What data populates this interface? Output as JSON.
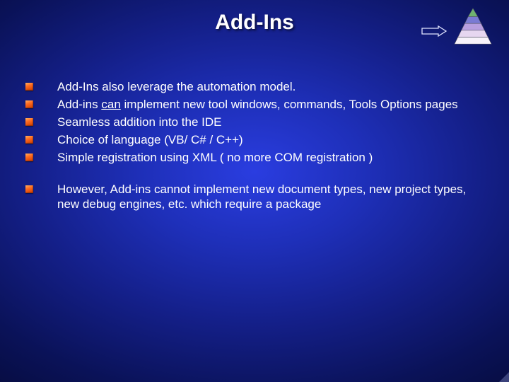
{
  "title": "Add-Ins",
  "bullets": {
    "group1": [
      {
        "text": "Add-Ins also leverage the automation model."
      },
      {
        "pre": "Add-ins ",
        "underlined": "can",
        "post": " implement new tool windows, commands, Tools Options pages"
      },
      {
        "text": "Seamless addition into the IDE"
      },
      {
        "text": "Choice of language (VB/ C# / C++)"
      },
      {
        "text": "Simple registration using XML ( no more COM registration )"
      }
    ],
    "group2": [
      {
        "text": "However, Add-ins cannot implement new document types, new project types, new debug engines, etc. which require a package"
      }
    ]
  },
  "colors": {
    "accent": "#ff6a20",
    "pyramid": [
      "#6fb36f",
      "#7a7ad4",
      "#b89fe0",
      "#e6d6f0",
      "#f7f2fa"
    ]
  }
}
